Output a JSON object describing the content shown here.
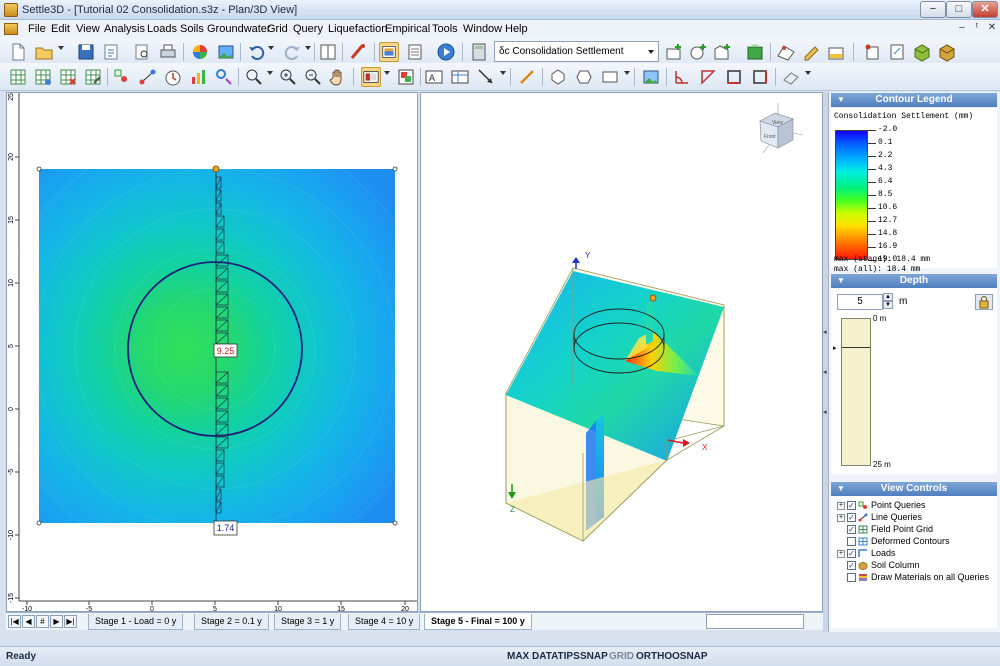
{
  "window": {
    "title": "Settle3D - [Tutorial 02 Consolidation.s3z - Plan/3D View]",
    "min_label": "−",
    "max_label": "□",
    "close_label": "✕"
  },
  "menu": [
    "File",
    "Edit",
    "View",
    "Analysis",
    "Loads",
    "Soils",
    "Groundwater",
    "Grid",
    "Query",
    "Liquefaction",
    "Empirical",
    "Tools",
    "Window",
    "Help"
  ],
  "mdi_controls": [
    "–",
    "ᵗ",
    "✕"
  ],
  "toolbar": {
    "result_select": "δc  Consolidation Settlement"
  },
  "plan_view": {
    "x_ticks": [
      "-10",
      "-5",
      "0",
      "5",
      "10",
      "15",
      "20"
    ],
    "y_ticks": [
      "20",
      "15",
      "10",
      "5",
      "0",
      "-5",
      "-10",
      "-15"
    ],
    "y_top_tick": "25",
    "label_center": "9.25",
    "label_bottom": "1.74"
  },
  "view3d": {
    "axis_y": "Y",
    "axis_x": "X",
    "axis_z": "Z",
    "cube_view": "View",
    "cube_front": "Front"
  },
  "contour_legend": {
    "header": "Contour Legend",
    "title": "Consolidation Settlement (mm)",
    "values": [
      "-2.0",
      "0.1",
      "2.2",
      "4.3",
      "6.4",
      "8.5",
      "10.6",
      "12.7",
      "14.8",
      "16.9",
      "19.0"
    ],
    "max_stage": "max (stage): 18.4 mm",
    "max_all": "max (all):   18.4 mm",
    "colors": [
      "#1500ff",
      "#0060ff",
      "#00b0ff",
      "#00f0e0",
      "#00f080",
      "#40ff20",
      "#c8ff00",
      "#ffe000",
      "#ff8000",
      "#ff1800"
    ]
  },
  "depth": {
    "header": "Depth",
    "value": "5",
    "unit": "m",
    "top_label": "0 m",
    "bottom_label": "25 m"
  },
  "view_controls": {
    "header": "View Controls",
    "items": [
      {
        "label": "Point Queries",
        "checked": true,
        "expand": "+"
      },
      {
        "label": "Line Queries",
        "checked": true,
        "expand": "+"
      },
      {
        "label": "Field Point Grid",
        "checked": true,
        "expand": ""
      },
      {
        "label": "Deformed Contours",
        "checked": false,
        "expand": ""
      },
      {
        "label": "Loads",
        "checked": true,
        "expand": "+"
      },
      {
        "label": "Soil Column",
        "checked": true,
        "expand": ""
      },
      {
        "label": "Draw Materials on all Queries",
        "checked": false,
        "expand": ""
      }
    ]
  },
  "tabs": {
    "nav": [
      "|◀",
      "◀",
      "#",
      "▶",
      "▶|"
    ],
    "items": [
      "Stage 1 - Load = 0 y",
      "Stage 2 = 0.1 y",
      "Stage 3 = 1 y",
      "Stage 4 = 10 y",
      "Stage 5 - Final = 100 y"
    ],
    "active_index": 4
  },
  "status": {
    "ready": "Ready",
    "max_datatips": "MAX DATATIPS",
    "snap": "SNAP",
    "grid": "GRID",
    "ortho": "ORTHO",
    "osnap": "OSNAP"
  }
}
